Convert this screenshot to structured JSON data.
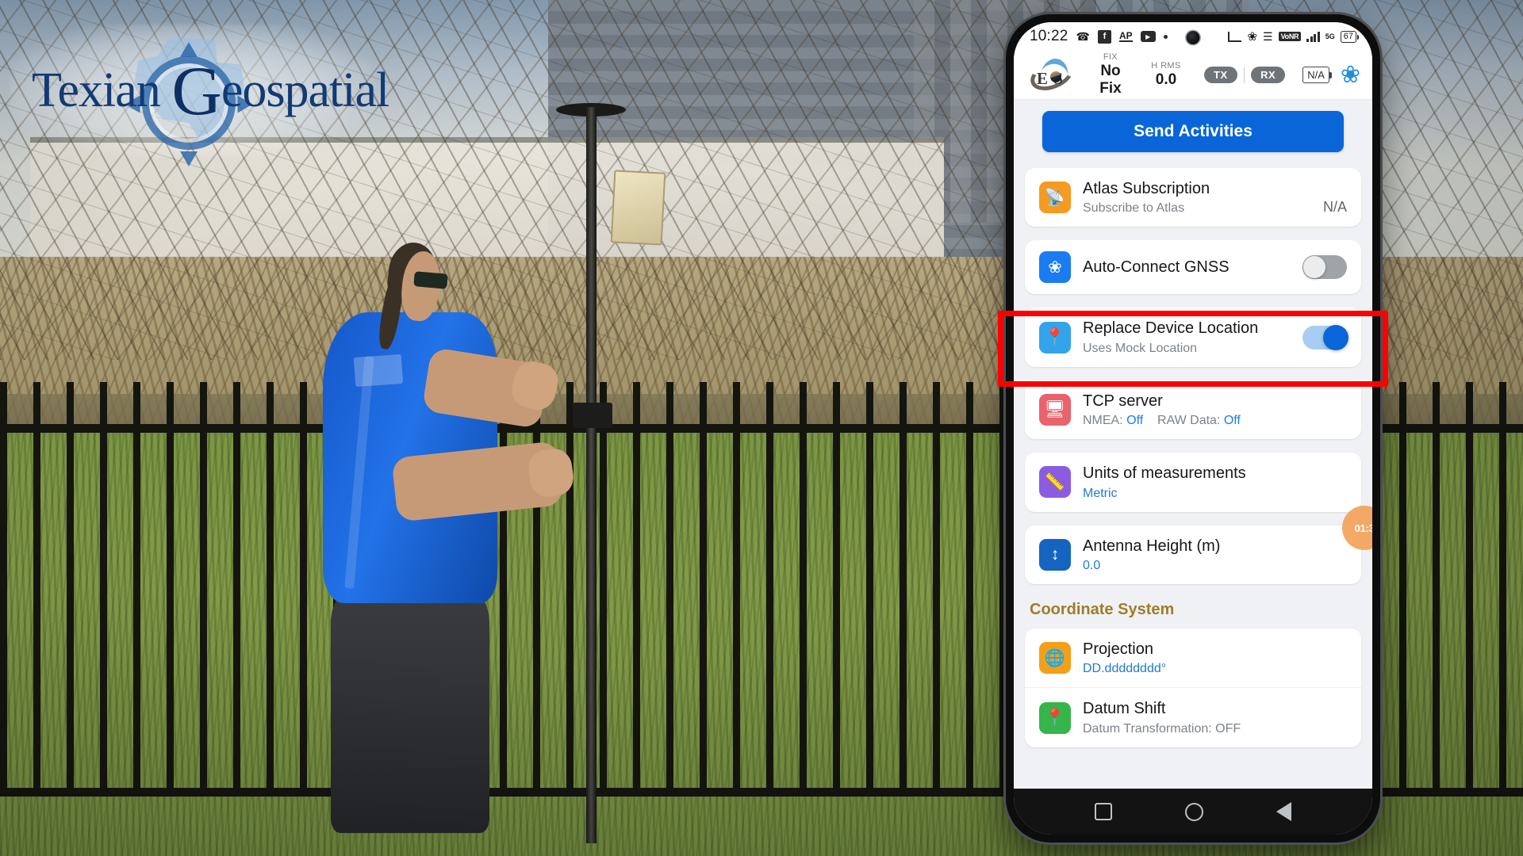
{
  "branding": {
    "logo_text_1": "Texian ",
    "logo_text_g": "G",
    "logo_text_2": "eospatial",
    "logo_alt": "texian-geospatial-logo"
  },
  "phone": {
    "statusbar": {
      "clock": "10:22",
      "icons_left": [
        "phone-missed-icon",
        "facebook-icon",
        "ap-news-icon",
        "youtube-icon",
        "dot-icon"
      ],
      "icons_right": [
        "screencast-icon",
        "bluetooth-icon",
        "vibrate-icon",
        "vonr-icon",
        "signal-bars-icon",
        "5g-icon"
      ],
      "vonr_label": "VoNR",
      "network_label": "5G",
      "battery_percent": "67"
    },
    "header": {
      "app_logo": "eos-logo",
      "fix_label": "FIX",
      "fix_value": "No Fix",
      "hrms_label": "H RMS",
      "hrms_value": "0.0",
      "tx_label": "TX",
      "rx_label": "RX",
      "battery_value": "N/A",
      "bluetooth_icon": "bluetooth-icon"
    },
    "send_button": "Send Activities",
    "settings": [
      {
        "id": "atlas-subscription",
        "icon": "satellite-icon",
        "icon_color": "#f79a22",
        "title": "Atlas Subscription",
        "subtitle": "Subscribe to Atlas",
        "right_value": "N/A",
        "control": "none"
      },
      {
        "id": "auto-connect-gnss",
        "icon": "bluetooth-icon",
        "icon_color": "#1a7cf0",
        "title": "Auto-Connect GNSS",
        "subtitle": "",
        "control": "toggle",
        "toggle_state": "off"
      },
      {
        "id": "replace-device-location",
        "icon": "location-pin-icon",
        "icon_color": "#33a3ec",
        "title": "Replace Device Location",
        "subtitle": "Uses Mock Location",
        "control": "toggle",
        "toggle_state": "on",
        "highlighted": true
      },
      {
        "id": "tcp-server",
        "icon": "server-icon",
        "icon_color": "#e8636b",
        "title": "TCP server",
        "subtitle_parts": [
          "NMEA:",
          "Off",
          "RAW Data:",
          "Off"
        ],
        "control": "none"
      },
      {
        "id": "units-of-measurements",
        "icon": "ruler-icon",
        "icon_color": "#8b5ce0",
        "title": "Units of measurements",
        "subtitle": "Metric",
        "control": "none"
      },
      {
        "id": "antenna-height",
        "icon": "antenna-height-icon",
        "icon_color": "#1565c0",
        "title": "Antenna Height (m)",
        "subtitle": "0.0",
        "control": "none"
      }
    ],
    "coordinate_system": {
      "section_label": "Coordinate System",
      "items": [
        {
          "id": "projection",
          "icon": "globe-icon",
          "icon_color": "#f59e18",
          "title": "Projection",
          "subtitle": "DD.dddddddd°"
        },
        {
          "id": "datum-shift",
          "icon": "datum-pin-icon",
          "icon_color": "#36b54a",
          "title": "Datum Shift",
          "subtitle": "Datum Transformation: OFF"
        }
      ]
    },
    "video_scrubber": {
      "timestamp": "01:3"
    },
    "navbar": {
      "recents": "recents-square-icon",
      "home": "home-circle-icon",
      "back": "back-triangle-icon"
    }
  },
  "colors": {
    "accent_blue": "#0a66d8",
    "highlight_red": "#ff0000",
    "section_gold": "#9c7e2a",
    "link_blue": "#1e7bd0"
  }
}
